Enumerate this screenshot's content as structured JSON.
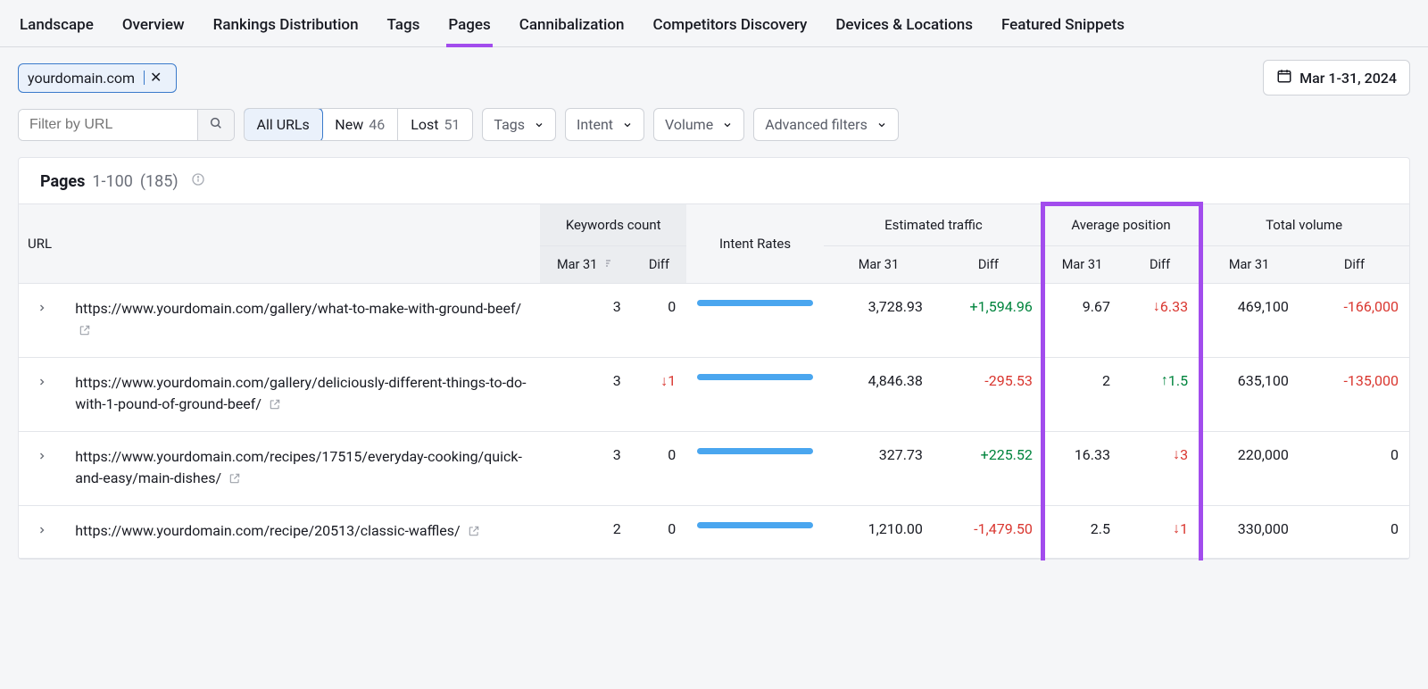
{
  "tabs": [
    "Landscape",
    "Overview",
    "Rankings Distribution",
    "Tags",
    "Pages",
    "Cannibalization",
    "Competitors Discovery",
    "Devices & Locations",
    "Featured Snippets"
  ],
  "active_tab_index": 4,
  "domain_chip": "yourdomain.com",
  "date_range": "Mar 1-31, 2024",
  "url_filter_placeholder": "Filter by URL",
  "url_seg": {
    "all": "All URLs",
    "new": "New",
    "new_count": "46",
    "lost": "Lost",
    "lost_count": "51"
  },
  "dd": {
    "tags": "Tags",
    "intent": "Intent",
    "volume": "Volume",
    "advanced": "Advanced filters"
  },
  "card": {
    "title": "Pages",
    "range": "1-100",
    "total": "(185)"
  },
  "columns": {
    "url": "URL",
    "kw": "Keywords count",
    "intent": "Intent Rates",
    "et": "Estimated traffic",
    "ap": "Average position",
    "tv": "Total volume",
    "sub_date": "Mar 31",
    "sub_diff": "Diff"
  },
  "rows": [
    {
      "url": "https://www.yourdomain.com/gallery/what-to-make-with-ground-beef/",
      "kw": "3",
      "kw_diff": "0",
      "et": "3,728.93",
      "et_diff": "+1,594.96",
      "et_sign": "pos",
      "ap": "9.67",
      "ap_diff": "6.33",
      "ap_dir": "down",
      "tv": "469,100",
      "tv_diff": "-166,000",
      "tv_sign": "neg"
    },
    {
      "url": "https://www.yourdomain.com/gallery/deliciously-different-things-to-do-with-1-pound-of-ground-beef/",
      "kw": "3",
      "kw_diff": "↓1",
      "kw_sign": "neg",
      "et": "4,846.38",
      "et_diff": "-295.53",
      "et_sign": "neg",
      "ap": "2",
      "ap_diff": "1.5",
      "ap_dir": "up",
      "tv": "635,100",
      "tv_diff": "-135,000",
      "tv_sign": "neg"
    },
    {
      "url": "https://www.yourdomain.com/recipes/17515/everyday-cooking/quick-and-easy/main-dishes/",
      "kw": "3",
      "kw_diff": "0",
      "et": "327.73",
      "et_diff": "+225.52",
      "et_sign": "pos",
      "ap": "16.33",
      "ap_diff": "3",
      "ap_dir": "down",
      "tv": "220,000",
      "tv_diff": "0",
      "tv_sign": "none"
    },
    {
      "url": "https://www.yourdomain.com/recipe/20513/classic-waffles/",
      "kw": "2",
      "kw_diff": "0",
      "et": "1,210.00",
      "et_diff": "-1,479.50",
      "et_sign": "neg",
      "ap": "2.5",
      "ap_diff": "1",
      "ap_dir": "down",
      "tv": "330,000",
      "tv_diff": "0",
      "tv_sign": "none"
    }
  ]
}
